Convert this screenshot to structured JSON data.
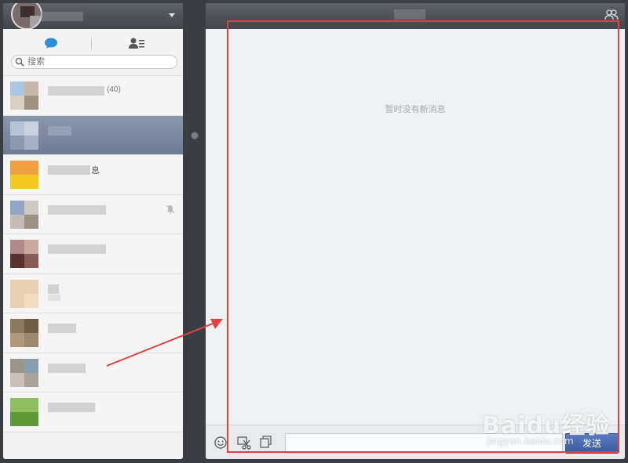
{
  "left_panel": {
    "search": {
      "placeholder": "搜索"
    },
    "contacts": [
      {
        "count": "(40)"
      },
      {},
      {
        "name_char": "息"
      },
      {
        "muted": true
      },
      {},
      {},
      {},
      {},
      {}
    ]
  },
  "chat": {
    "empty_message": "暂时没有新消息",
    "send_label": "发送"
  },
  "watermark": {
    "logo": "Baidu经验",
    "url": "jingyan.baidu.com"
  },
  "colors": {
    "highlight": "#e14040",
    "send_button": "#4a6bb0",
    "selected_row": "#7a879d"
  }
}
